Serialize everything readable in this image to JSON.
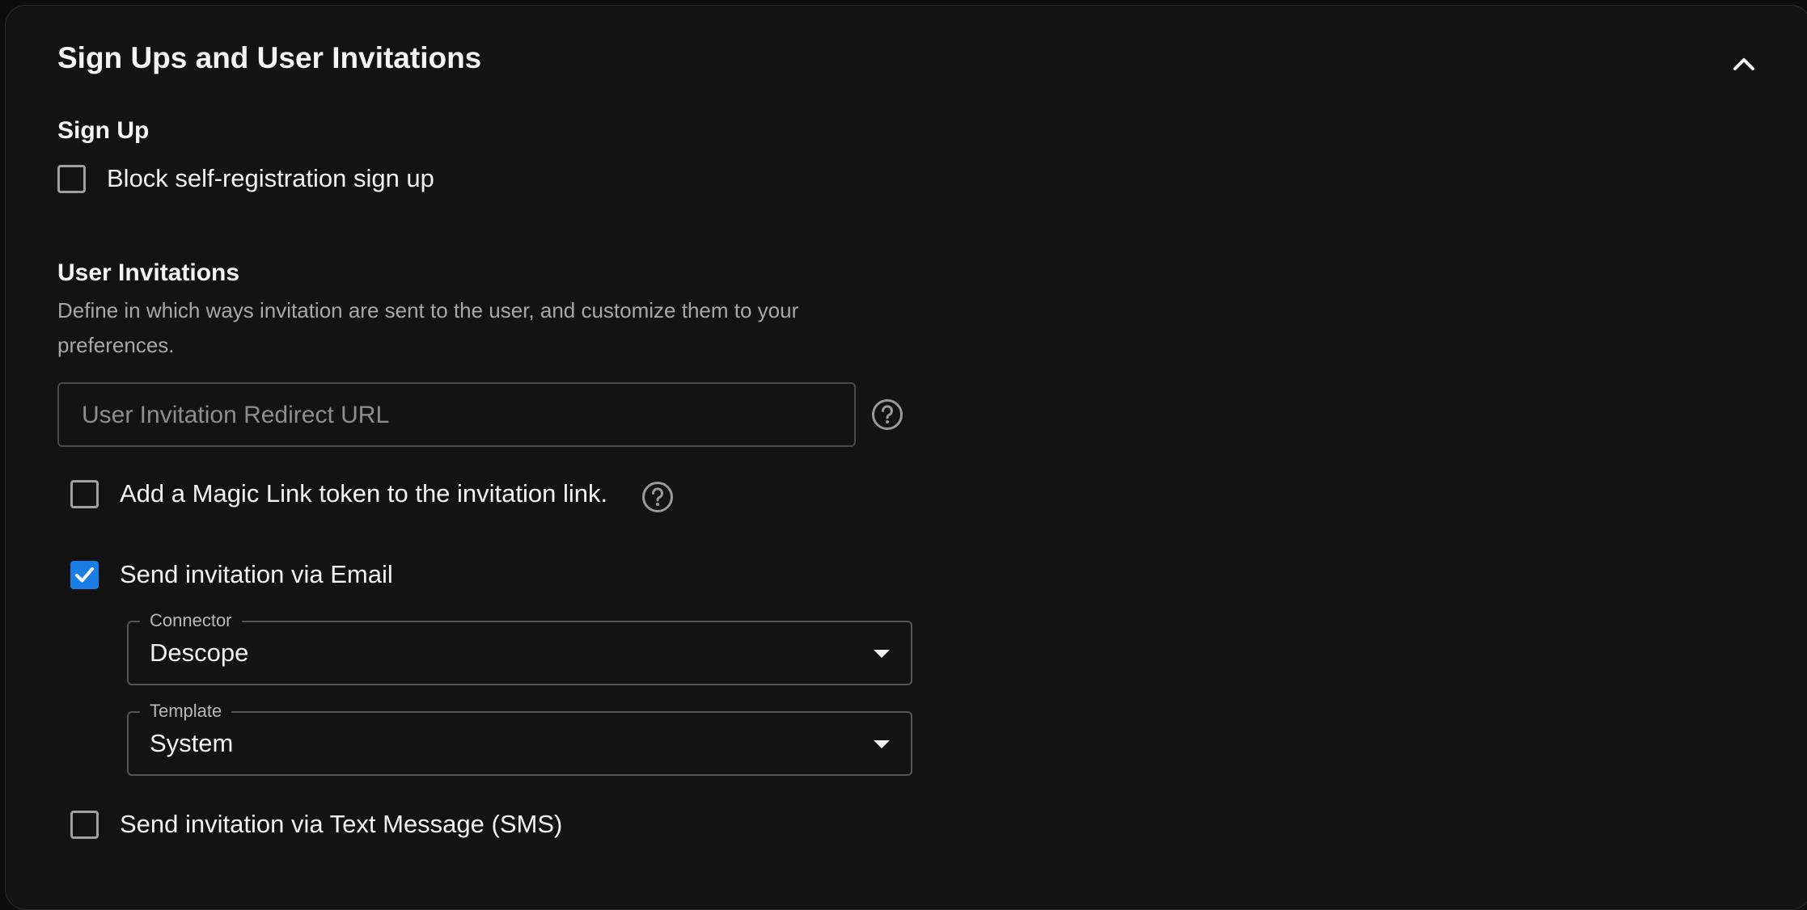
{
  "section": {
    "title": "Sign Ups and User Invitations"
  },
  "sign_up": {
    "heading": "Sign Up",
    "block_label": "Block self-registration sign up",
    "block_checked": false
  },
  "invitations": {
    "heading": "User Invitations",
    "description": "Define in which ways invitation are sent to the user, and customize them to your preferences.",
    "redirect_url": {
      "placeholder": "User Invitation Redirect URL",
      "value": ""
    },
    "magic_link": {
      "label": "Add a Magic Link token to the invitation link.",
      "checked": false
    },
    "email": {
      "label": "Send invitation via Email",
      "checked": true,
      "connector": {
        "label": "Connector",
        "value": "Descope"
      },
      "template": {
        "label": "Template",
        "value": "System"
      }
    },
    "sms": {
      "label": "Send invitation via Text Message (SMS)",
      "checked": false
    }
  },
  "icons": {
    "collapse": "chevron-up-icon",
    "help": "help-circle-icon",
    "check": "checkmark-icon",
    "dropdown": "caret-down-icon"
  },
  "colors": {
    "background": "#131313",
    "accent": "#1a7de6",
    "text": "#f2f2f2",
    "muted": "#a8a8a8"
  }
}
